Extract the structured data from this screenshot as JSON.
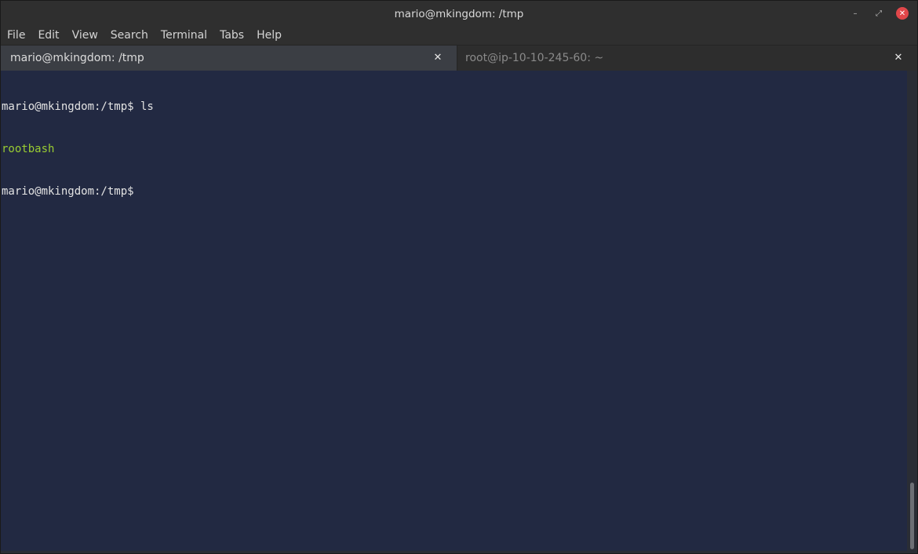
{
  "window": {
    "title": "mario@mkingdom: /tmp",
    "controls": {
      "minimize": "–",
      "maximize": "⤢",
      "close": "✕"
    }
  },
  "menubar": {
    "items": [
      "File",
      "Edit",
      "View",
      "Search",
      "Terminal",
      "Tabs",
      "Help"
    ]
  },
  "tabs": [
    {
      "label": "mario@mkingdom: /tmp",
      "close": "✕",
      "active": true
    },
    {
      "label": "root@ip-10-10-245-60: ~",
      "close": "✕",
      "active": false
    }
  ],
  "terminal": {
    "lines": [
      {
        "text": "mario@mkingdom:/tmp$ ls"
      },
      {
        "text": "rootbash",
        "color": "#9acd32"
      },
      {
        "text": "mario@mkingdom:/tmp$"
      }
    ]
  },
  "colors": {
    "terminal_bg": "#222942",
    "accent_green": "#9acd32",
    "close_button": "#e0474a"
  }
}
